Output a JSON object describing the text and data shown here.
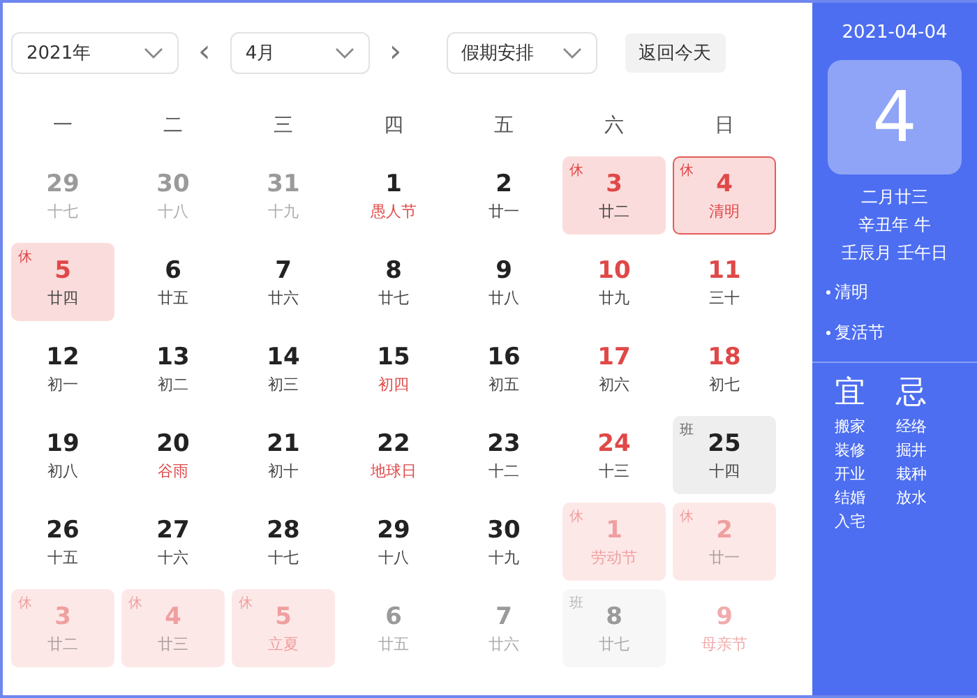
{
  "toolbar": {
    "year_select": "2021年",
    "prev": "‹",
    "month_select": "4月",
    "next": "›",
    "holiday_select": "假期安排",
    "today_button": "返回今天"
  },
  "weekdays": [
    "一",
    "二",
    "三",
    "四",
    "五",
    "六",
    "日"
  ],
  "days": [
    {
      "day": "29",
      "lunar": "十七",
      "in_month": false,
      "weekend": false,
      "festival": false,
      "kind": "normal",
      "selected": false
    },
    {
      "day": "30",
      "lunar": "十八",
      "in_month": false,
      "weekend": false,
      "festival": false,
      "kind": "normal",
      "selected": false
    },
    {
      "day": "31",
      "lunar": "十九",
      "in_month": false,
      "weekend": false,
      "festival": false,
      "kind": "normal",
      "selected": false
    },
    {
      "day": "1",
      "lunar": "愚人节",
      "in_month": true,
      "weekend": false,
      "festival": true,
      "kind": "normal",
      "selected": false
    },
    {
      "day": "2",
      "lunar": "廿一",
      "in_month": true,
      "weekend": false,
      "festival": false,
      "kind": "normal",
      "selected": false
    },
    {
      "day": "3",
      "lunar": "廿二",
      "in_month": true,
      "festival": false,
      "kind": "rest",
      "badge": "休",
      "selected": false
    },
    {
      "day": "4",
      "lunar": "清明",
      "in_month": true,
      "festival": true,
      "kind": "rest",
      "badge": "休",
      "selected": true
    },
    {
      "day": "5",
      "lunar": "廿四",
      "in_month": true,
      "festival": false,
      "kind": "rest",
      "badge": "休",
      "selected": false
    },
    {
      "day": "6",
      "lunar": "廿五",
      "in_month": true,
      "weekend": false,
      "festival": false,
      "kind": "normal",
      "selected": false
    },
    {
      "day": "7",
      "lunar": "廿六",
      "in_month": true,
      "weekend": false,
      "festival": false,
      "kind": "normal",
      "selected": false
    },
    {
      "day": "8",
      "lunar": "廿七",
      "in_month": true,
      "weekend": false,
      "festival": false,
      "kind": "normal",
      "selected": false
    },
    {
      "day": "9",
      "lunar": "廿八",
      "in_month": true,
      "weekend": false,
      "festival": false,
      "kind": "normal",
      "selected": false
    },
    {
      "day": "10",
      "lunar": "廿九",
      "in_month": true,
      "weekend": true,
      "festival": false,
      "kind": "normal",
      "selected": false
    },
    {
      "day": "11",
      "lunar": "三十",
      "in_month": true,
      "weekend": true,
      "festival": false,
      "kind": "normal",
      "selected": false
    },
    {
      "day": "12",
      "lunar": "初一",
      "in_month": true,
      "weekend": false,
      "festival": false,
      "kind": "normal",
      "selected": false
    },
    {
      "day": "13",
      "lunar": "初二",
      "in_month": true,
      "weekend": false,
      "festival": false,
      "kind": "normal",
      "selected": false
    },
    {
      "day": "14",
      "lunar": "初三",
      "in_month": true,
      "weekend": false,
      "festival": false,
      "kind": "normal",
      "selected": false
    },
    {
      "day": "15",
      "lunar": "初四",
      "in_month": true,
      "weekend": false,
      "festival": true,
      "kind": "normal",
      "selected": false
    },
    {
      "day": "16",
      "lunar": "初五",
      "in_month": true,
      "weekend": false,
      "festival": false,
      "kind": "normal",
      "selected": false
    },
    {
      "day": "17",
      "lunar": "初六",
      "in_month": true,
      "weekend": true,
      "festival": false,
      "kind": "normal",
      "selected": false
    },
    {
      "day": "18",
      "lunar": "初七",
      "in_month": true,
      "weekend": true,
      "festival": false,
      "kind": "normal",
      "selected": false
    },
    {
      "day": "19",
      "lunar": "初八",
      "in_month": true,
      "weekend": false,
      "festival": false,
      "kind": "normal",
      "selected": false
    },
    {
      "day": "20",
      "lunar": "谷雨",
      "in_month": true,
      "weekend": false,
      "festival": true,
      "kind": "normal",
      "selected": false
    },
    {
      "day": "21",
      "lunar": "初十",
      "in_month": true,
      "weekend": false,
      "festival": false,
      "kind": "normal",
      "selected": false
    },
    {
      "day": "22",
      "lunar": "地球日",
      "in_month": true,
      "weekend": false,
      "festival": true,
      "kind": "normal",
      "selected": false
    },
    {
      "day": "23",
      "lunar": "十二",
      "in_month": true,
      "weekend": false,
      "festival": false,
      "kind": "normal",
      "selected": false
    },
    {
      "day": "24",
      "lunar": "十三",
      "in_month": true,
      "weekend": true,
      "festival": false,
      "kind": "normal",
      "selected": false
    },
    {
      "day": "25",
      "lunar": "十四",
      "in_month": true,
      "festival": false,
      "kind": "work",
      "badge": "班",
      "selected": false
    },
    {
      "day": "26",
      "lunar": "十五",
      "in_month": true,
      "weekend": false,
      "festival": false,
      "kind": "normal",
      "selected": false
    },
    {
      "day": "27",
      "lunar": "十六",
      "in_month": true,
      "weekend": false,
      "festival": false,
      "kind": "normal",
      "selected": false
    },
    {
      "day": "28",
      "lunar": "十七",
      "in_month": true,
      "weekend": false,
      "festival": false,
      "kind": "normal",
      "selected": false
    },
    {
      "day": "29",
      "lunar": "十八",
      "in_month": true,
      "weekend": false,
      "festival": false,
      "kind": "normal",
      "selected": false
    },
    {
      "day": "30",
      "lunar": "十九",
      "in_month": true,
      "weekend": false,
      "festival": false,
      "kind": "normal",
      "selected": false
    },
    {
      "day": "1",
      "lunar": "劳动节",
      "in_month": false,
      "festival": true,
      "kind": "rest",
      "badge": "休",
      "selected": false
    },
    {
      "day": "2",
      "lunar": "廿一",
      "in_month": false,
      "festival": false,
      "kind": "rest",
      "badge": "休",
      "selected": false
    },
    {
      "day": "3",
      "lunar": "廿二",
      "in_month": false,
      "festival": false,
      "kind": "rest",
      "badge": "休",
      "selected": false
    },
    {
      "day": "4",
      "lunar": "廿三",
      "in_month": false,
      "festival": false,
      "kind": "rest",
      "badge": "休",
      "selected": false
    },
    {
      "day": "5",
      "lunar": "立夏",
      "in_month": false,
      "festival": true,
      "kind": "rest",
      "badge": "休",
      "selected": false
    },
    {
      "day": "6",
      "lunar": "廿五",
      "in_month": false,
      "weekend": false,
      "festival": false,
      "kind": "normal",
      "selected": false
    },
    {
      "day": "7",
      "lunar": "廿六",
      "in_month": false,
      "weekend": false,
      "festival": false,
      "kind": "normal",
      "selected": false
    },
    {
      "day": "8",
      "lunar": "廿七",
      "in_month": false,
      "festival": false,
      "kind": "work",
      "badge": "班",
      "selected": false
    },
    {
      "day": "9",
      "lunar": "母亲节",
      "in_month": false,
      "weekend": true,
      "festival": true,
      "kind": "normal",
      "selected": false
    }
  ],
  "detail": {
    "date": "2021-04-04",
    "day": "4",
    "lunar_date": "二月廿三",
    "year_text": "辛丑年 牛",
    "ganzhi": "壬辰月 壬午日",
    "festivals": [
      "清明",
      "复活节"
    ],
    "suitable": {
      "title": "宜",
      "items": [
        "搬家",
        "装修",
        "开业",
        "结婚",
        "入宅"
      ]
    },
    "avoid": {
      "title": "忌",
      "items": [
        "经络",
        "掘井",
        "栽种",
        "放水"
      ]
    }
  }
}
